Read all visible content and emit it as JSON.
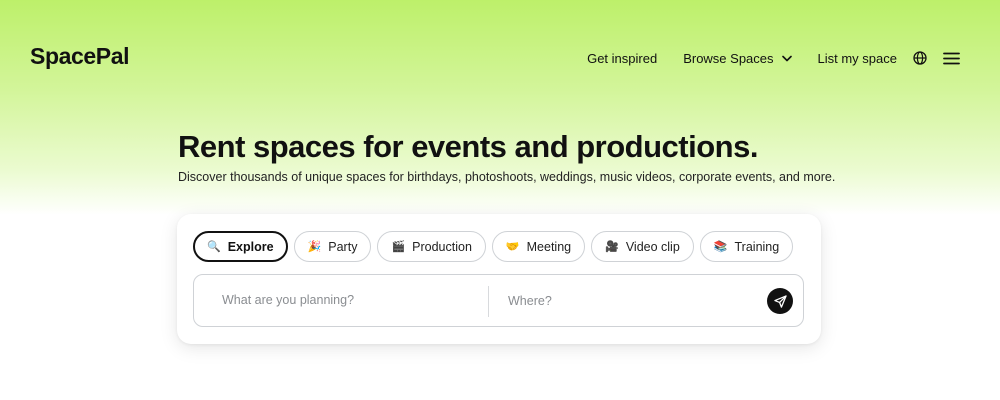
{
  "header": {
    "logo": "SpacePal",
    "nav": {
      "get_inspired": "Get inspired",
      "browse_spaces": "Browse Spaces",
      "list_my_space": "List my space"
    },
    "icons": [
      "chevron-down-icon",
      "globe-icon",
      "hamburger-menu-icon"
    ]
  },
  "hero": {
    "title": "Rent spaces for events and productions.",
    "subtitle": "Discover thousands of unique spaces for birthdays, photoshoots, weddings, music videos, corporate events, and more."
  },
  "search_card": {
    "tabs": [
      {
        "label": "Explore",
        "icon": "🔍",
        "active": true
      },
      {
        "label": "Party",
        "icon": "🎉",
        "active": false
      },
      {
        "label": "Production",
        "icon": "🎬",
        "active": false
      },
      {
        "label": "Meeting",
        "icon": "🤝",
        "active": false
      },
      {
        "label": "Video clip",
        "icon": "🎥",
        "active": false
      },
      {
        "label": "Training",
        "icon": "📚",
        "active": false
      }
    ],
    "activity_input": {
      "value": "",
      "placeholder": "What are you planning?"
    },
    "location_input": {
      "value": "",
      "placeholder": "Where?"
    },
    "submit_icon": "send-arrow-icon"
  },
  "colors": {
    "gradient_top": "#bdf06a",
    "text": "#111111",
    "border": "#cfd2d6",
    "button": "#111111"
  }
}
